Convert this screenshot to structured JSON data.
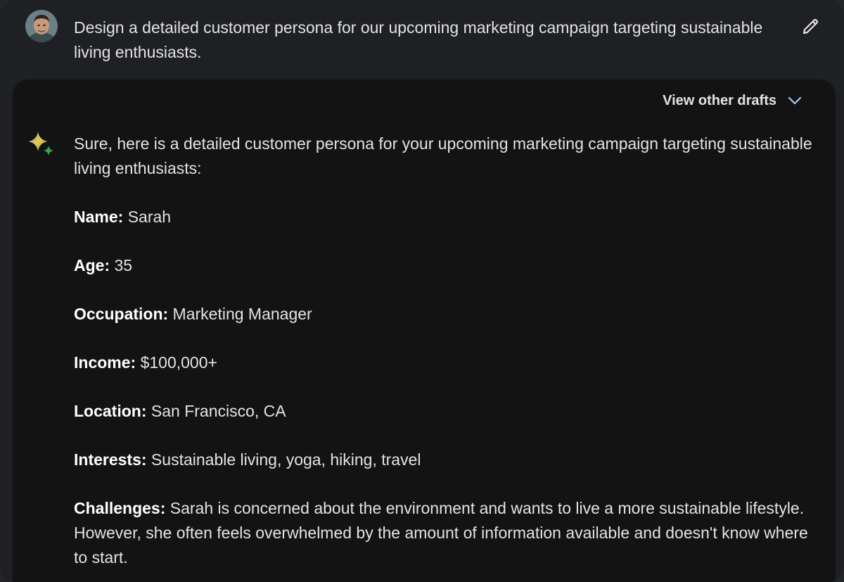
{
  "prompt": {
    "text": "Design a detailed customer persona for our upcoming marketing campaign targeting sustainable living enthusiasts.",
    "edit_icon": "pencil-icon"
  },
  "response": {
    "drafts_label": "View other drafts",
    "drafts_icon": "chevron-down-icon",
    "logo_icon": "sparkle-icon",
    "intro": "Sure, here is a detailed customer persona for your upcoming marketing campaign targeting sustainable living enthusiasts:",
    "fields": [
      {
        "label": "Name:",
        "value": " Sarah"
      },
      {
        "label": "Age:",
        "value": " 35"
      },
      {
        "label": "Occupation:",
        "value": " Marketing Manager"
      },
      {
        "label": "Income:",
        "value": " $100,000+"
      },
      {
        "label": "Location:",
        "value": " San Francisco, CA"
      },
      {
        "label": "Interests:",
        "value": " Sustainable living, yoga, hiking, travel"
      },
      {
        "label": "Challenges:",
        "value": " Sarah is concerned about the environment and wants to live a more sustainable lifestyle. However, she often feels overwhelmed by the amount of information available and doesn't know where to start."
      }
    ]
  },
  "colors": {
    "background": "#1f2024",
    "card": "#131314",
    "text": "#e3e3e3",
    "chevron": "#a8c7fa"
  }
}
